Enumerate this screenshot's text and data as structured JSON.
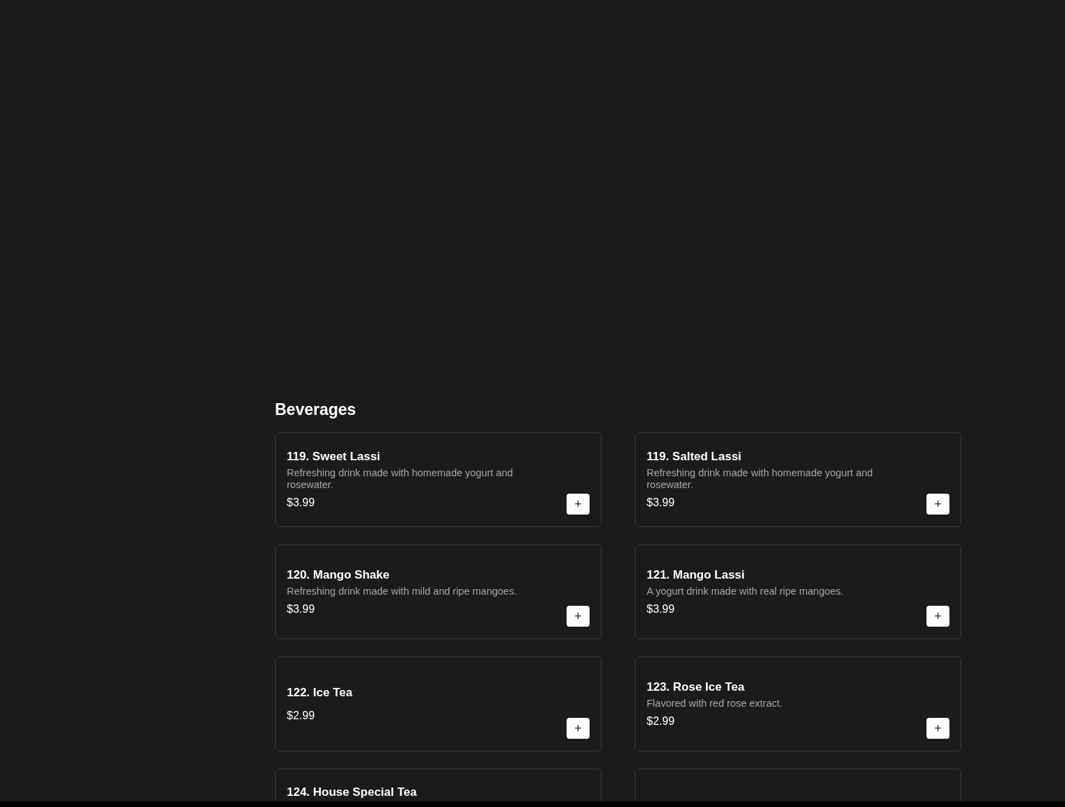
{
  "section": {
    "title": "Beverages"
  },
  "items": [
    {
      "kind": "item",
      "name": "119. Sweet Lassi",
      "description": "Refreshing drink made with homemade yogurt and rosewater.",
      "price": "$3.99",
      "add": "+"
    },
    {
      "kind": "item",
      "name": "119. Salted Lassi",
      "description": "Refreshing drink made with homemade yogurt and rosewater.",
      "price": "$3.99",
      "add": "+"
    },
    {
      "kind": "item",
      "name": "120. Mango Shake",
      "description": "Refreshing drink made with mild and ripe mangoes.",
      "price": "$3.99",
      "add": "+"
    },
    {
      "kind": "item",
      "name": "121. Mango Lassi",
      "description": "A yogurt drink made with real ripe mangoes.",
      "price": "$3.99",
      "add": "+"
    },
    {
      "kind": "item",
      "name": "122. Ice Tea",
      "price": "$2.99",
      "add": "+"
    },
    {
      "kind": "item",
      "name": "123. Rose Ice Tea",
      "description": "Flavored with red rose extract.",
      "price": "$2.99",
      "add": "+"
    },
    {
      "kind": "partial",
      "name": "124. House Special Tea"
    },
    {
      "kind": "blank"
    }
  ]
}
